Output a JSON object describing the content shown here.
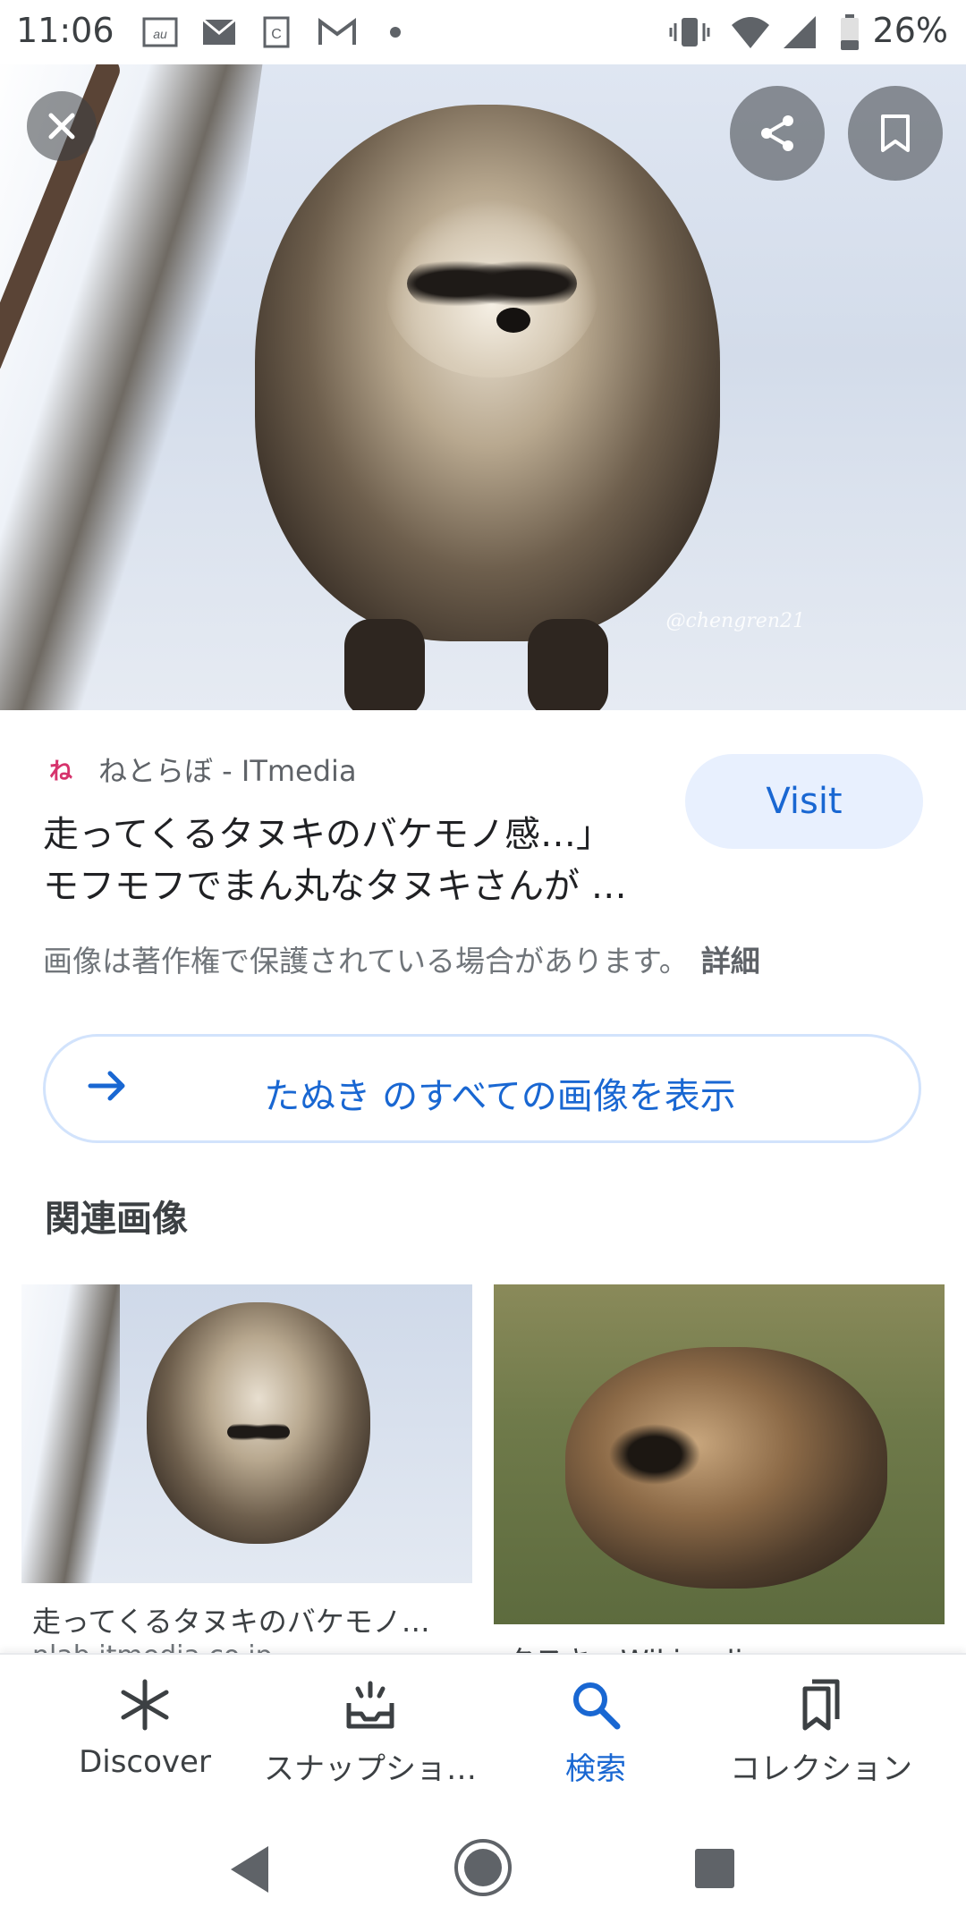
{
  "status_bar": {
    "time": "11:06",
    "battery": "26%",
    "icons": [
      "au-icon",
      "au-mail-icon",
      "clipboard-icon",
      "gmail-icon",
      "dot-icon",
      "vibrate-icon",
      "wifi-icon",
      "signal-icon",
      "battery-icon"
    ]
  },
  "hero": {
    "watermark": "@chengren21"
  },
  "result": {
    "source_favicon": "ね",
    "source": "ねとらぼ - ITmedia",
    "title_line1": "走ってくるタヌキのバケモノ感…」",
    "title_line2": "モフモフでまん丸なタヌキさんが …",
    "visit_label": "Visit",
    "copyright_notice": "画像は著作権で保護されている場合があります。",
    "details_label": "詳細"
  },
  "view_all": {
    "label": "たぬき のすべての画像を表示"
  },
  "related": {
    "heading": "関連画像",
    "items": [
      {
        "caption": "走ってくるタヌキのバケモノ…",
        "source": "nlab.itmedia.co.jp"
      },
      {
        "caption": "タヌキ - Wikipedia",
        "source": ""
      }
    ]
  },
  "bottom_nav": {
    "items": [
      {
        "label": "Discover",
        "icon": "asterisk-icon",
        "active": false
      },
      {
        "label": "スナップショ…",
        "icon": "inbox-icon",
        "active": false
      },
      {
        "label": "検索",
        "icon": "search-icon",
        "active": true
      },
      {
        "label": "コレクション",
        "icon": "bookmarks-icon",
        "active": false
      }
    ]
  },
  "colors": {
    "accent": "#1967d2",
    "visit_bg": "#e8f0fe",
    "text_primary": "#202124",
    "text_secondary": "#70757a"
  }
}
